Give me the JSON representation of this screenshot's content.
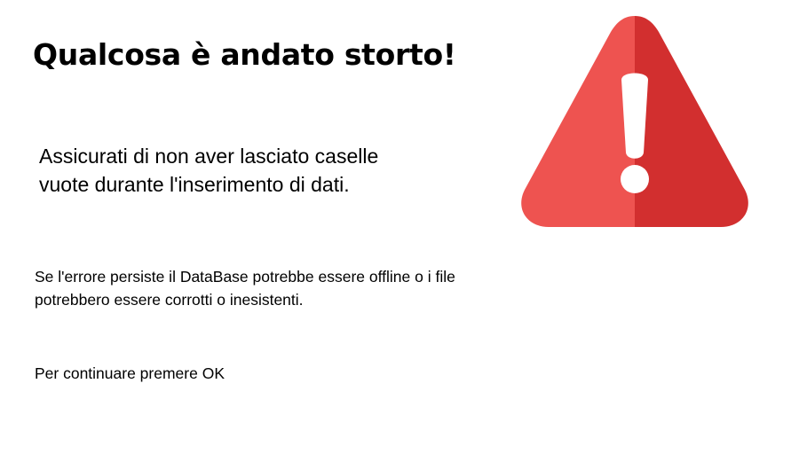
{
  "dialog": {
    "title": "Qualcosa è andato storto!",
    "hint": "Assicurati di non aver lasciato caselle vuote durante l'inserimento di dati.",
    "detail": "Se l'errore persiste il DataBase potrebbe essere offline o i file potrebbero essere corrotti o inesistenti.",
    "continue_prompt": "Per continuare premere OK",
    "icon": "warning-triangle-exclamation",
    "colors": {
      "icon_light": "#ee5350",
      "icon_dark": "#d22f2f",
      "icon_mark": "#ffffff"
    }
  }
}
